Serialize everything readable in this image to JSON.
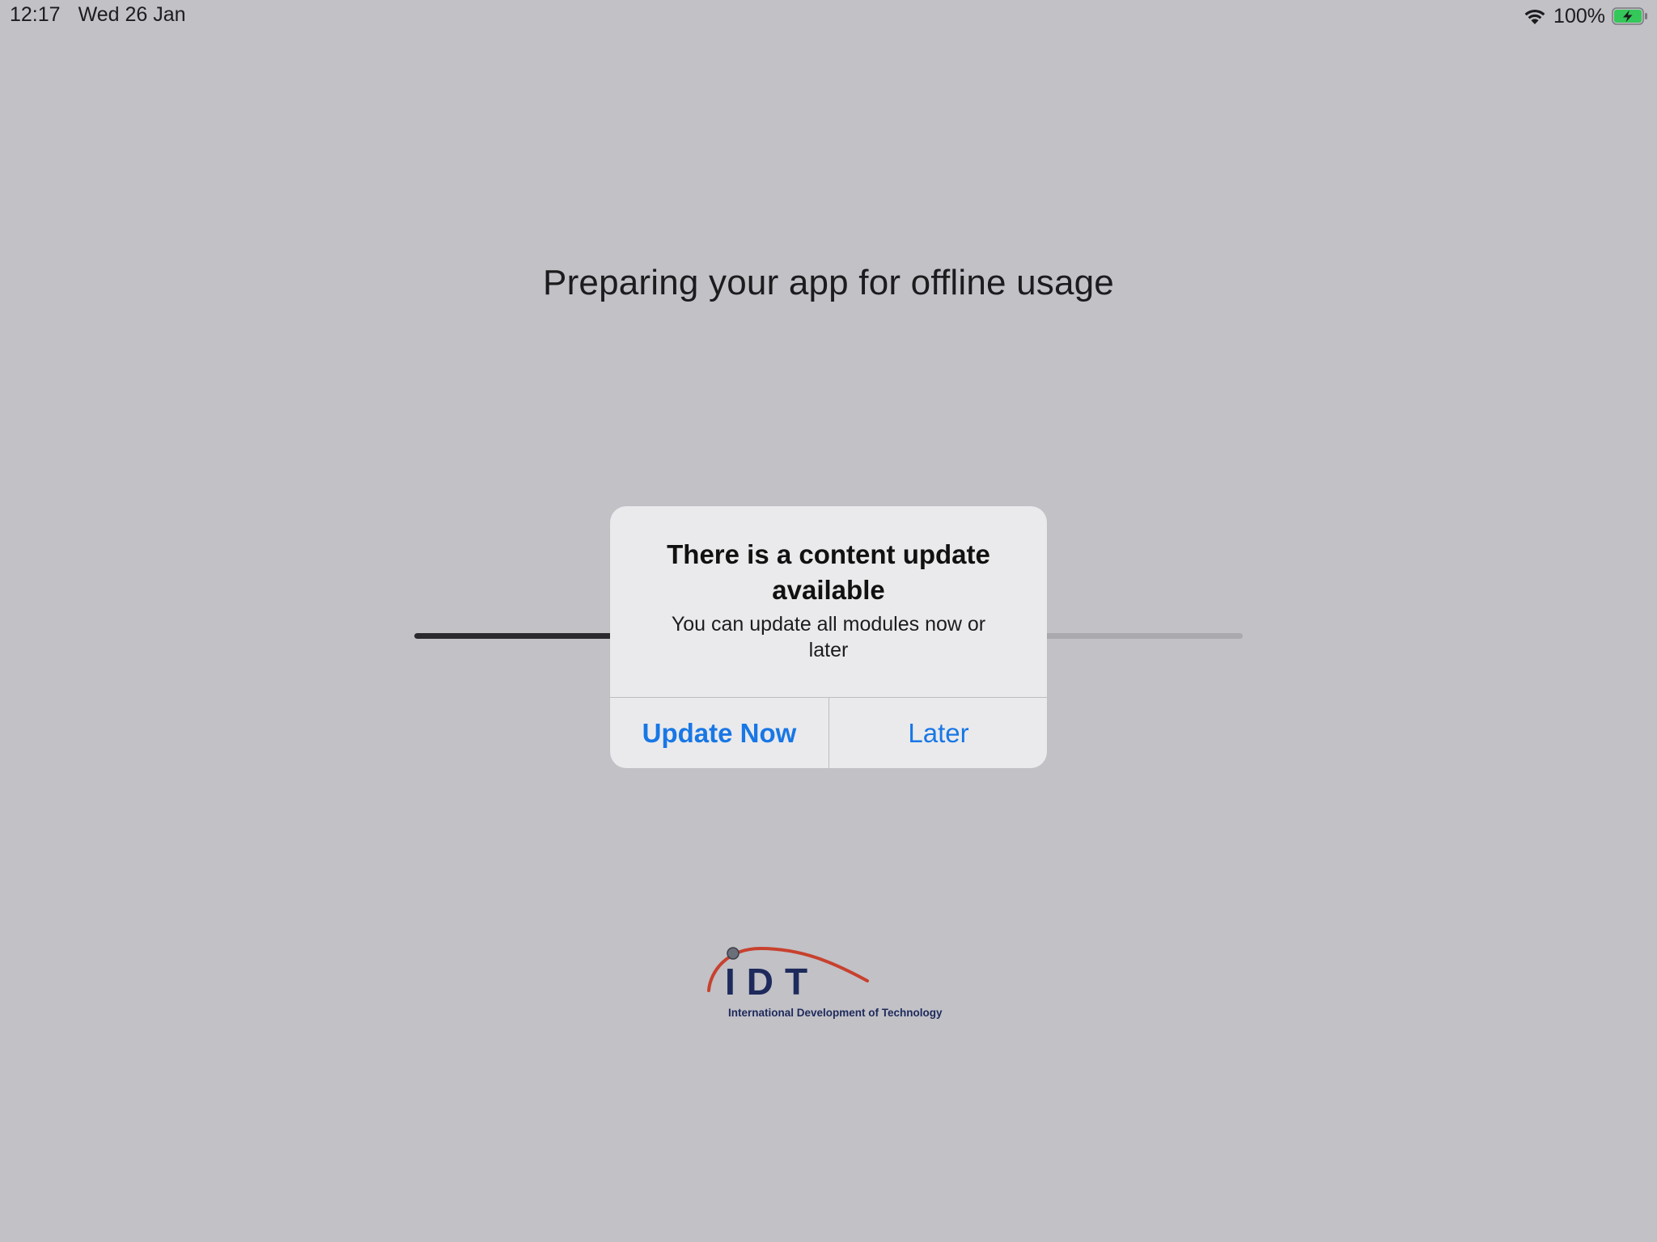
{
  "status_bar": {
    "time": "12:17",
    "date": "Wed 26 Jan",
    "battery_percent": "100%",
    "battery_level": 1.0,
    "battery_color": "#34c759",
    "wifi_icon": "wifi-icon",
    "battery_icon": "battery-charging-icon"
  },
  "page": {
    "title": "Preparing your app for offline usage"
  },
  "progress": {
    "value": 0.24,
    "fill_color": "#2a2a2e",
    "track_color": "#a9a9ae"
  },
  "alert": {
    "title": "There is a content update available",
    "message": "You can update all modules now or later",
    "primary_button": "Update Now",
    "secondary_button": "Later",
    "accent_color": "#1877e5"
  },
  "logo": {
    "text": "IDT",
    "tagline": "International Development of Technology",
    "brand_color": "#1e2a5c",
    "arc_color": "#c8412e"
  }
}
